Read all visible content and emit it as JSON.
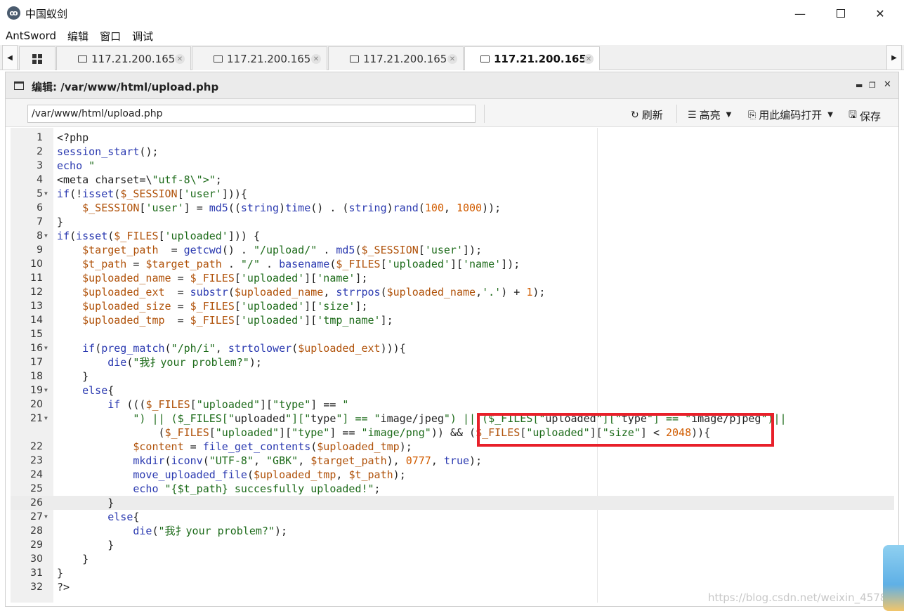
{
  "window": {
    "title": "中国蚁剑",
    "icon": "antsword-logo-icon",
    "controls": [
      "minimize",
      "maximize",
      "close"
    ]
  },
  "menu": [
    "AntSword",
    "编辑",
    "窗口",
    "调试"
  ],
  "tabs": [
    {
      "label": "117.21.200.165",
      "active": false
    },
    {
      "label": "117.21.200.165",
      "active": false
    },
    {
      "label": "117.21.200.165",
      "active": false
    },
    {
      "label": "117.21.200.165",
      "active": true
    }
  ],
  "panel": {
    "title": "编辑: /var/www/html/upload.php"
  },
  "toolbar": {
    "path_value": "/var/www/html/upload.php",
    "refresh_label": "刷新",
    "highlight_label": "高亮",
    "open_with_encoding_label": "用此编码打开",
    "save_label": "保存"
  },
  "editor": {
    "active_line": 26,
    "lines": [
      {
        "n": "1",
        "text": "<?php"
      },
      {
        "n": "2",
        "text": "session_start();"
      },
      {
        "n": "3",
        "text": "echo \""
      },
      {
        "n": "4",
        "text": "<meta charset=\\\"utf-8\\\">\";"
      },
      {
        "n": "5",
        "text": "if(!isset($_SESSION['user'])){"
      },
      {
        "n": "6",
        "text": "    $_SESSION['user'] = md5((string)time() . (string)rand(100, 1000));"
      },
      {
        "n": "7",
        "text": "}"
      },
      {
        "n": "8",
        "text": "if(isset($_FILES['uploaded'])) {"
      },
      {
        "n": "9",
        "text": "    $target_path  = getcwd() . \"/upload/\" . md5($_SESSION['user']);"
      },
      {
        "n": "10",
        "text": "    $t_path = $target_path . \"/\" . basename($_FILES['uploaded']['name']);"
      },
      {
        "n": "11",
        "text": "    $uploaded_name = $_FILES['uploaded']['name'];"
      },
      {
        "n": "12",
        "text": "    $uploaded_ext  = substr($uploaded_name, strrpos($uploaded_name,'.') + 1);"
      },
      {
        "n": "13",
        "text": "    $uploaded_size = $_FILES['uploaded']['size'];"
      },
      {
        "n": "14",
        "text": "    $uploaded_tmp  = $_FILES['uploaded']['tmp_name'];"
      },
      {
        "n": "15",
        "text": ""
      },
      {
        "n": "16",
        "text": "    if(preg_match(\"/ph/i\", strtolower($uploaded_ext))){"
      },
      {
        "n": "17",
        "text": "        die(\"我扌your problem?\");"
      },
      {
        "n": "18",
        "text": "    }"
      },
      {
        "n": "19",
        "text": "    else{"
      },
      {
        "n": "20",
        "text": "        if ((($_FILES[\"uploaded\"][\"type\"] == \""
      },
      {
        "n": "21",
        "text": "            \") || ($_FILES[\"uploaded\"][\"type\"] == \"image/jpeg\") || ($_FILES[\"uploaded\"][\"type\"] == \"image/pjpeg\")||"
      },
      {
        "n": "",
        "text": "                ($_FILES[\"uploaded\"][\"type\"] == \"image/png\")) && ($_FILES[\"uploaded\"][\"size\"] < 2048)){"
      },
      {
        "n": "22",
        "text": "            $content = file_get_contents($uploaded_tmp);"
      },
      {
        "n": "23",
        "text": "            mkdir(iconv(\"UTF-8\", \"GBK\", $target_path), 0777, true);"
      },
      {
        "n": "24",
        "text": "            move_uploaded_file($uploaded_tmp, $t_path);"
      },
      {
        "n": "25",
        "text": "            echo \"{$t_path} succesfully uploaded!\";"
      },
      {
        "n": "26",
        "text": "        }"
      },
      {
        "n": "27",
        "text": "        else{"
      },
      {
        "n": "28",
        "text": "            die(\"我扌your problem?\");"
      },
      {
        "n": "29",
        "text": "        }"
      },
      {
        "n": "30",
        "text": "    }"
      },
      {
        "n": "31",
        "text": "}"
      },
      {
        "n": "32",
        "text": "?>"
      }
    ],
    "folds": [
      "5",
      "8",
      "16",
      "19",
      "21",
      "27"
    ]
  },
  "watermark": "https://blog.csdn.net/weixin_45782091",
  "colors": {
    "highlight_box": "#e8202a",
    "keyword": "#2a39b0",
    "string": "#1d6b1a",
    "number": "#d15c00"
  }
}
